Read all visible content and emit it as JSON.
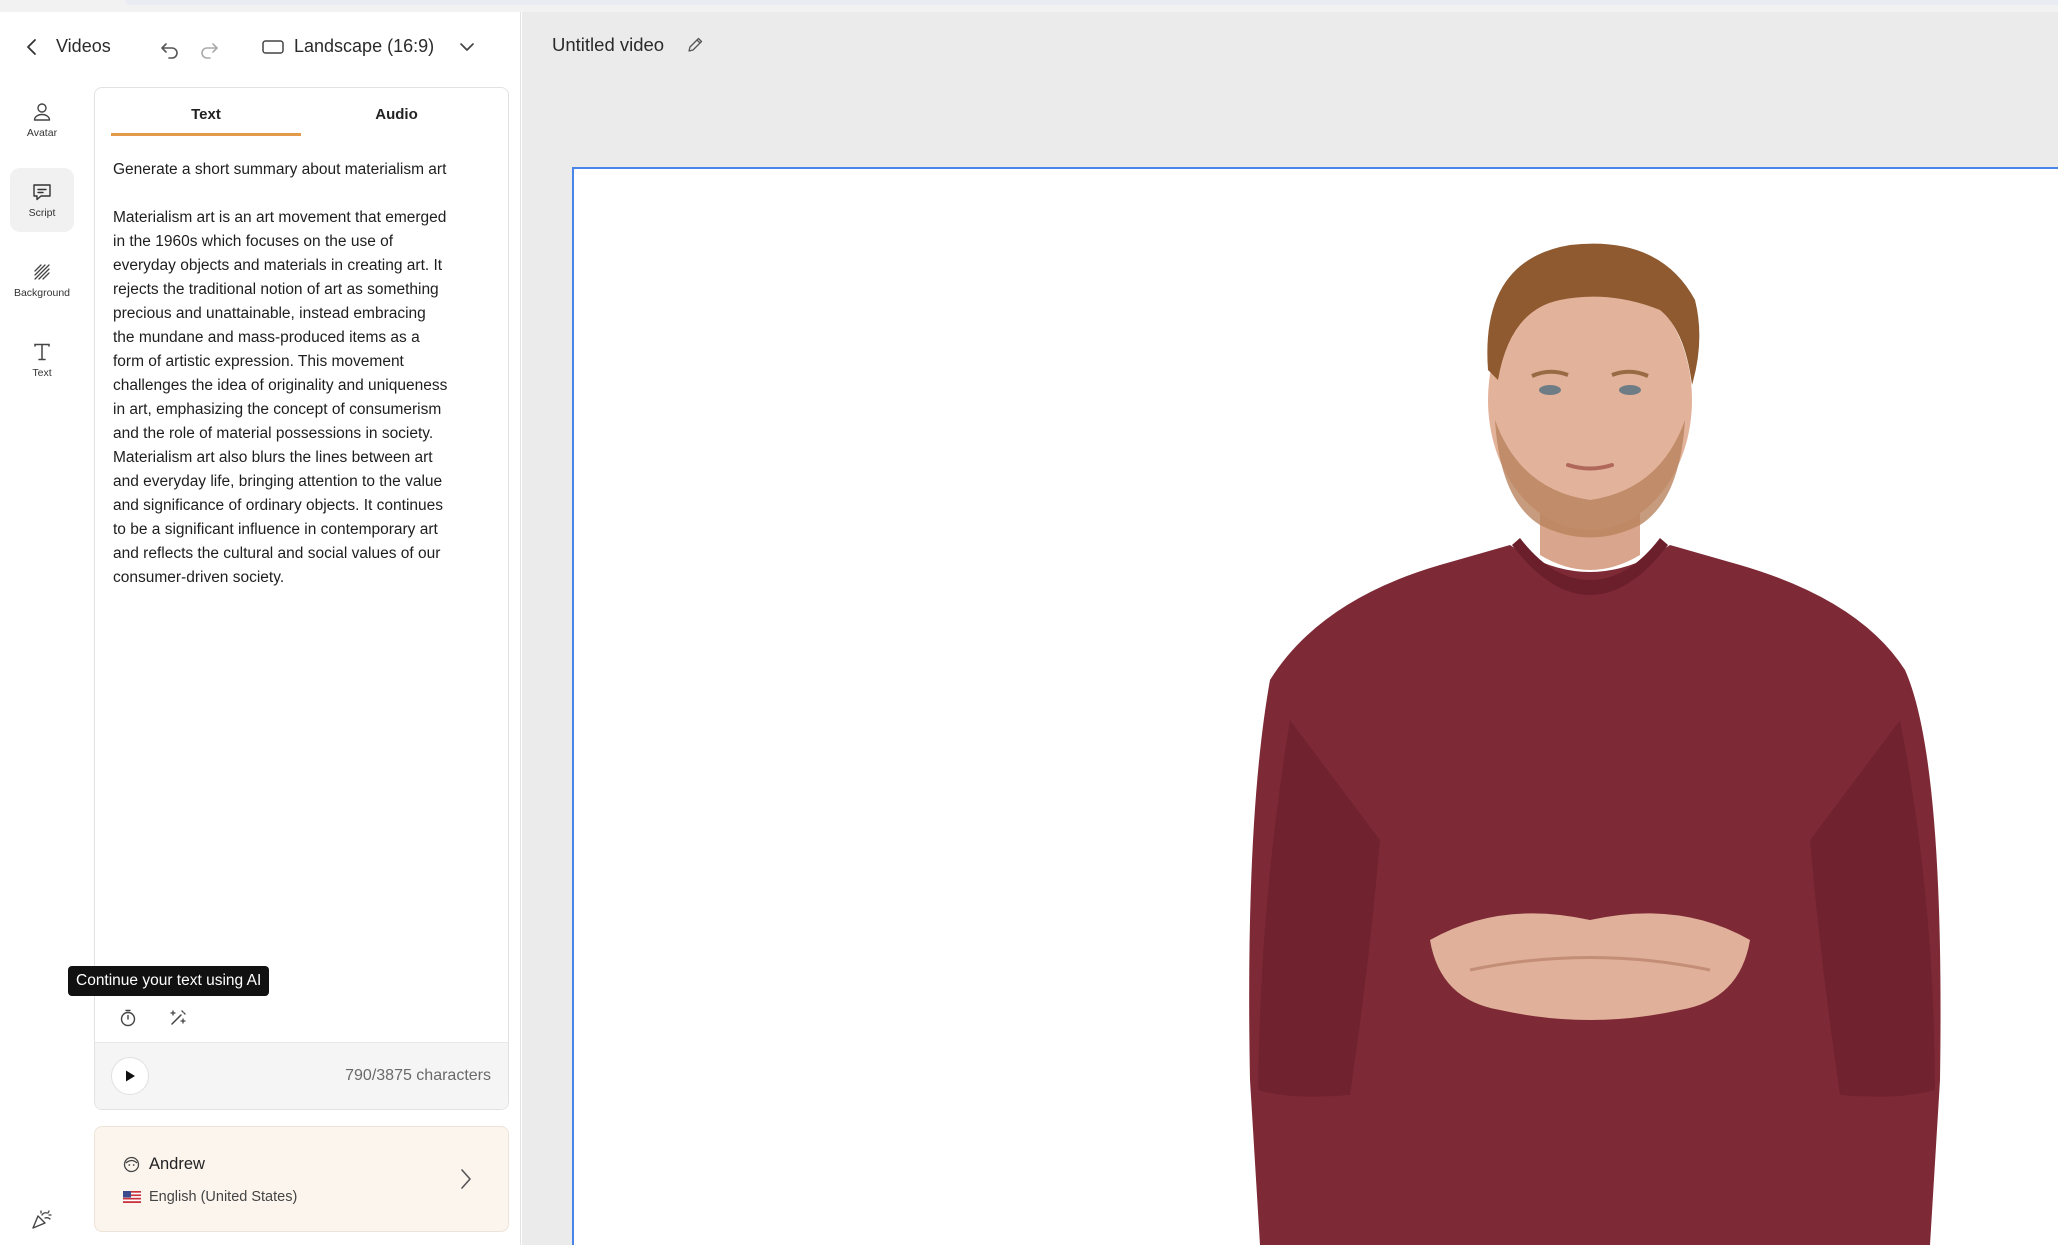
{
  "header": {
    "back_label": "Videos",
    "aspect_label": "Landscape (16:9)"
  },
  "nav": [
    {
      "label": "Avatar",
      "icon": "person-icon"
    },
    {
      "label": "Script",
      "icon": "chat-bubble-icon",
      "active": true
    },
    {
      "label": "Background",
      "icon": "hatch-pattern-icon"
    },
    {
      "label": "Text",
      "icon": "text-t-icon"
    }
  ],
  "script": {
    "tabs": [
      "Text",
      "Audio"
    ],
    "active_tab": "Text",
    "content": "Generate a short summary about materialism art\n\nMaterialism art is an art movement that emerged\nin the 1960s which focuses on the use of\neveryday objects and materials in creating art. It\nrejects the traditional notion of art as something\nprecious and unattainable, instead embracing\nthe mundane and mass-produced items as a\nform of artistic expression. This movement\nchallenges the idea of originality and uniqueness\nin art, emphasizing the concept of consumerism\nand the role of material possessions in society.\nMaterialism art also blurs the lines between art\nand everyday life, bringing attention to the value\nand significance of ordinary objects. It continues\nto be a significant influence in contemporary art\nand reflects the cultural and social values of our\nconsumer-driven society.",
    "tooltip": "Continue your text using AI",
    "char_count": "790/3875 characters"
  },
  "voice": {
    "name": "Andrew",
    "language": "English (United States)"
  },
  "video": {
    "title": "Untitled video"
  },
  "colors": {
    "accent_tab": "#e39a4a",
    "selection": "#4a86e8",
    "voice_card_bg": "#fbf5ee",
    "sweater": "#7e2a36"
  }
}
